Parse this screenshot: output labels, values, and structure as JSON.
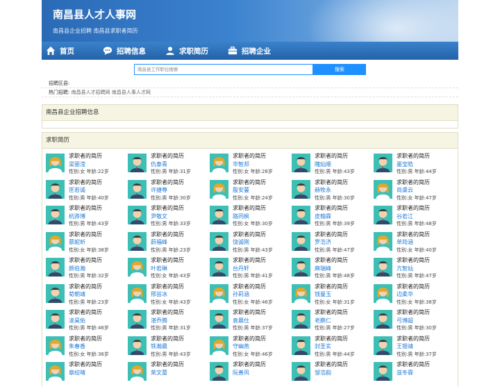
{
  "header": {
    "title": "南昌县人才人事网",
    "subtitle": "南昌县企业招聘 南昌县求职者简历"
  },
  "nav": [
    {
      "label": "首页",
      "icon": "home-icon"
    },
    {
      "label": "招聘信息",
      "icon": "chat-icon"
    },
    {
      "label": "求职简历",
      "icon": "user-icon"
    },
    {
      "label": "招聘企业",
      "icon": "briefcase-icon"
    }
  ],
  "search": {
    "placeholder": "南昌县工作职位搜索",
    "button": "搜索"
  },
  "region": {
    "label": "招聘区县:"
  },
  "hot": {
    "label": "热门招聘:",
    "links": "南昌县人才招聘网 南昌县人事人才网"
  },
  "panel_company": {
    "title": "南昌县企业招聘信息"
  },
  "panel_resume": {
    "title": "求职简历"
  },
  "card_title": "求职者的简历",
  "resumes": [
    {
      "name": "梁丽滢",
      "detail": "性别:女 年龄:22岁",
      "g": "f"
    },
    {
      "name": "仇泰青",
      "detail": "性别:男 年龄:31岁",
      "g": "m"
    },
    {
      "name": "华智邦",
      "detail": "性别:女 年龄:28岁",
      "g": "f"
    },
    {
      "name": "隗灿顺",
      "detail": "性别:男 年龄:43岁",
      "g": "m"
    },
    {
      "name": "墨宝皓",
      "detail": "性别:男 年龄:44岁",
      "g": "m"
    },
    {
      "name": "匡若诚",
      "detail": "性别:男 年龄:40岁",
      "g": "m"
    },
    {
      "name": "许捷尊",
      "detail": "性别:男 年龄:30岁",
      "g": "m"
    },
    {
      "name": "殷安蔓",
      "detail": "性别:女 年龄:24岁",
      "g": "f"
    },
    {
      "name": "赫牧永",
      "detail": "性别:男 年龄:30岁",
      "g": "m"
    },
    {
      "name": "尚虞云",
      "detail": "性别:女 年龄:47岁",
      "g": "f"
    },
    {
      "name": "杭骅博",
      "detail": "性别:男 年龄:43岁",
      "g": "m"
    },
    {
      "name": "尹敬文",
      "detail": "性别:男 年龄:33岁",
      "g": "m"
    },
    {
      "name": "路同枫",
      "detail": "性别:女 年龄:30岁",
      "g": "m"
    },
    {
      "name": "皮翰霖",
      "detail": "性别:男 年龄:39岁",
      "g": "m"
    },
    {
      "name": "谷若江",
      "detail": "性别:男 年龄:48岁",
      "g": "m"
    },
    {
      "name": "慕妮昕",
      "detail": "性别:女 年龄:38岁",
      "g": "f"
    },
    {
      "name": "蔚福峰",
      "detail": "性别:男 年龄:23岁",
      "g": "m"
    },
    {
      "name": "饶诚刚",
      "detail": "性别:男 年龄:43岁",
      "g": "m"
    },
    {
      "name": "罗浩济",
      "detail": "性别:男 年龄:47岁",
      "g": "m"
    },
    {
      "name": "单筠涵",
      "detail": "性别:女 年龄:40岁",
      "g": "f"
    },
    {
      "name": "颜伯瀚",
      "detail": "性别:男 年龄:32岁",
      "g": "m"
    },
    {
      "name": "叶若琳",
      "detail": "性别:女 年龄:43岁",
      "g": "f"
    },
    {
      "name": "台丹轩",
      "detail": "性别:男 年龄:41岁",
      "g": "m"
    },
    {
      "name": "麻瑞峰",
      "detail": "性别:男 年龄:48岁",
      "g": "m"
    },
    {
      "name": "亢智灿",
      "detail": "性别:男 年龄:47岁",
      "g": "m"
    },
    {
      "name": "荀朝靖",
      "detail": "性别:男 年龄:23岁",
      "g": "m"
    },
    {
      "name": "邢芸冰",
      "detail": "性别:女 年龄:43岁",
      "g": "f"
    },
    {
      "name": "孙莉涵",
      "detail": "性别:女 年龄:46岁",
      "g": "f"
    },
    {
      "name": "钱曼玉",
      "detail": "性别:女 年龄:31岁",
      "g": "f"
    },
    {
      "name": "边柔华",
      "detail": "性别:女 年龄:38岁",
      "g": "f"
    },
    {
      "name": "凌昊佑",
      "detail": "性别:男 年龄:46岁",
      "g": "m"
    },
    {
      "name": "湛乔腾",
      "detail": "性别:男 年龄:31岁",
      "g": "m"
    },
    {
      "name": "袁晨仕",
      "detail": "性别:男 年龄:37岁",
      "g": "m"
    },
    {
      "name": "老鹏仁",
      "detail": "性别:男 年龄:27岁",
      "g": "m"
    },
    {
      "name": "弓博超",
      "detail": "性别:男 年龄:30岁",
      "g": "m"
    },
    {
      "name": "朱春香",
      "detail": "性别:女 年龄:36岁",
      "g": "f"
    },
    {
      "name": "铁瀚晨",
      "detail": "性别:男 年龄:43岁",
      "g": "m"
    },
    {
      "name": "守幽燕",
      "detail": "性别:女 年龄:46岁",
      "g": "f"
    },
    {
      "name": "封圣玄",
      "detail": "性别:男 年龄:44岁",
      "g": "m"
    },
    {
      "name": "王银靖",
      "detail": "性别:男 年龄:37岁",
      "g": "m"
    },
    {
      "name": "章绞晴",
      "detail": "",
      "g": "f"
    },
    {
      "name": "荣文蕾",
      "detail": "",
      "g": "f"
    },
    {
      "name": "阮善风",
      "detail": "",
      "g": "m"
    },
    {
      "name": "邹浩韵",
      "detail": "",
      "g": "m"
    },
    {
      "name": "滋冬霖",
      "detail": "",
      "g": "m"
    }
  ],
  "colors": {
    "nav": "#2a6db8",
    "link": "#1e78d6",
    "avatar_bg": "#3dbfb5"
  }
}
